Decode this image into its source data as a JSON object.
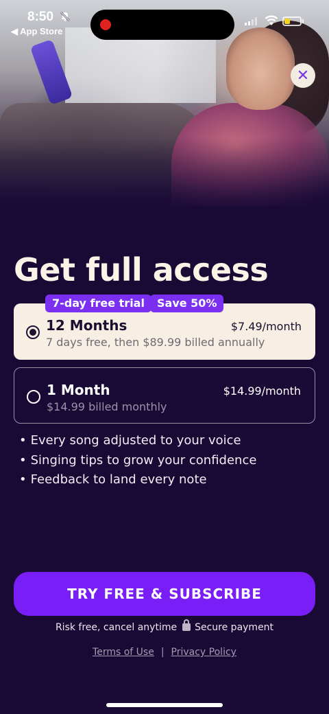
{
  "status_bar": {
    "time": "8:50",
    "bell_icon": "bell-slash-icon",
    "back_label": "◀ App Store",
    "battery_level": 0.35,
    "battery_color": "#f7d51e",
    "recording_color": "#e0231f"
  },
  "close_icon": "✕",
  "title": "Get full access",
  "tags": {
    "trial": "7-day free trial",
    "save": "Save 50%"
  },
  "plans": [
    {
      "name": "12 Months",
      "price": "$7.49/month",
      "description": "7 days free, then $89.99 billed annually",
      "selected": true
    },
    {
      "name": "1 Month",
      "price": "$14.99/month",
      "description": "$14.99 billed monthly",
      "selected": false
    }
  ],
  "features": [
    "Every song adjusted to your voice",
    "Singing tips to grow your confidence",
    "Feedback to land every note"
  ],
  "cta_label": "TRY FREE & SUBSCRIBE",
  "assurance": {
    "risk": "Risk free, cancel anytime",
    "secure": "Secure payment"
  },
  "legal": {
    "terms": "Terms of Use",
    "separator": "|",
    "privacy": "Privacy Policy"
  },
  "colors": {
    "background": "#190a35",
    "accent": "#7a1ef7",
    "tag": "#7b2ff0",
    "selected_card": "#f7efe3"
  }
}
